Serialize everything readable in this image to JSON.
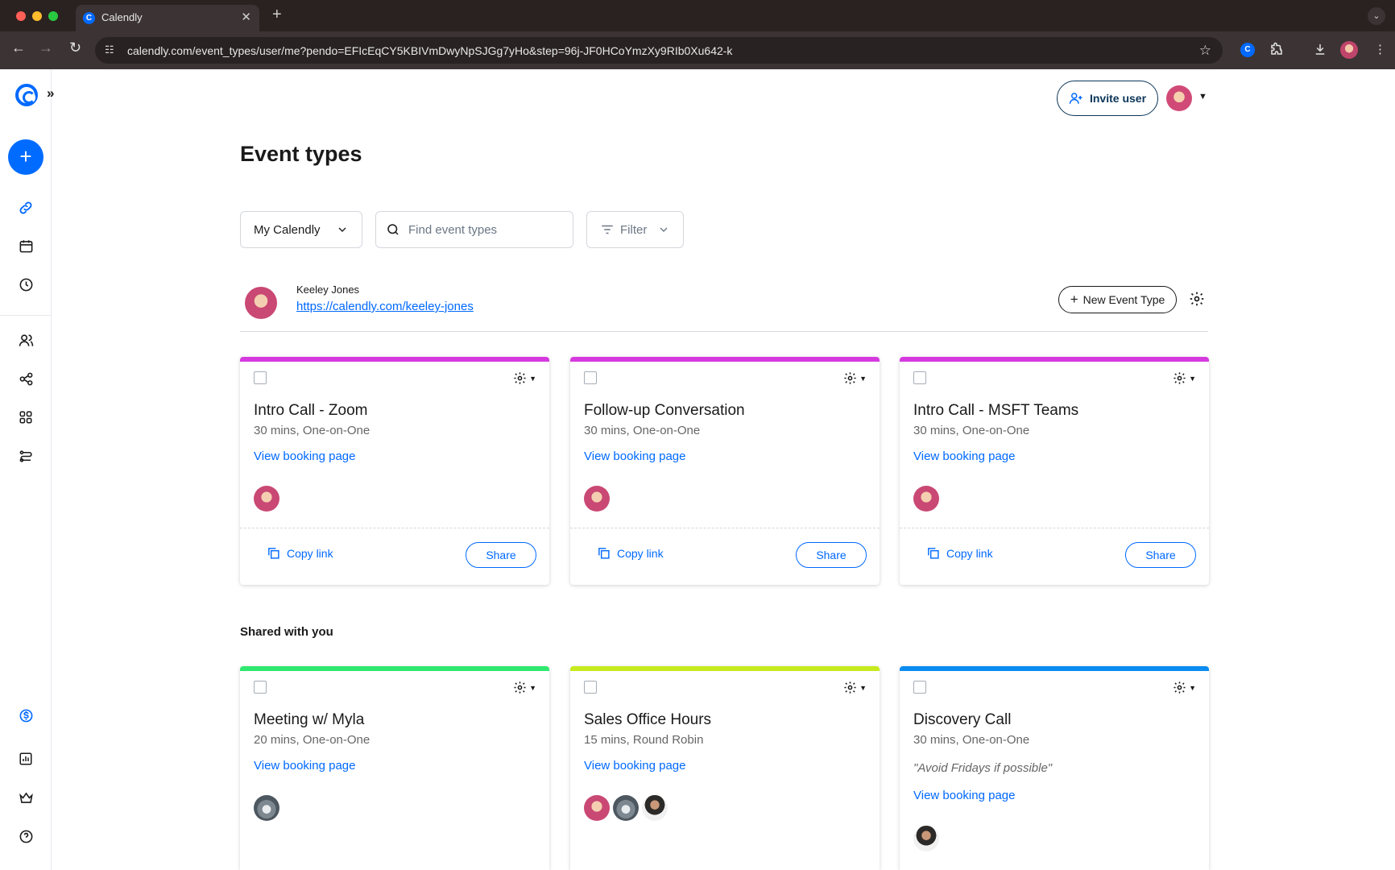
{
  "browser": {
    "tab_title": "Calendly",
    "tab_favicon": "C",
    "url": "calendly.com/event_types/user/me?pendo=EFIcEqCY5KBIVmDwyNpSJGg7yHo&step=96j-JF0HCoYmzXy9RIb0Xu642-k",
    "icons": [
      "back-icon",
      "forward-icon",
      "reload-icon",
      "site-info-icon",
      "bookmark-star-icon",
      "extension-icon",
      "download-icon",
      "profile-avatar",
      "menu-kebab-icon"
    ]
  },
  "sidebar": {
    "create_label": "+",
    "icons": [
      "calendly-logo",
      "expand-icon",
      "link-icon",
      "calendar-icon",
      "clock-icon",
      "contacts-icon",
      "workflows-icon",
      "apps-icon",
      "routing-icon",
      "billing-icon",
      "analytics-icon",
      "admin-crown-icon",
      "help-icon"
    ]
  },
  "header": {
    "invite_label": "Invite user"
  },
  "page": {
    "title": "Event types"
  },
  "filters": {
    "calendar_select": "My Calendly",
    "search_placeholder": "Find event types",
    "filter_label": "Filter"
  },
  "owner": {
    "name": "Keeley Jones",
    "url": "https://calendly.com/keeley-jones",
    "new_event_label": "New Event Type"
  },
  "my_events": [
    {
      "title": "Intro Call - Zoom",
      "meta": "30 mins, One-on-One",
      "link": "View booking page",
      "color": "#d63adf",
      "copy_label": "Copy link",
      "share_label": "Share"
    },
    {
      "title": "Follow-up Conversation",
      "meta": "30 mins, One-on-One",
      "link": "View booking page",
      "color": "#d63adf",
      "copy_label": "Copy link",
      "share_label": "Share"
    },
    {
      "title": "Intro Call - MSFT Teams",
      "meta": "30 mins, One-on-One",
      "link": "View booking page",
      "color": "#d63adf",
      "copy_label": "Copy link",
      "share_label": "Share"
    }
  ],
  "shared_heading": "Shared with you",
  "shared_events": [
    {
      "title": "Meeting w/ Myla",
      "meta": "20 mins, One-on-One",
      "link": "View booking page",
      "color": "#2ee86f"
    },
    {
      "title": "Sales Office Hours",
      "meta": "15 mins, Round Robin",
      "link": "View booking page",
      "color": "#c6ea1e"
    },
    {
      "title": "Discovery Call",
      "meta": "30 mins, One-on-One",
      "note": "\"Avoid Fridays if possible\"",
      "link": "View booking page",
      "color": "#0a8cf0"
    }
  ]
}
